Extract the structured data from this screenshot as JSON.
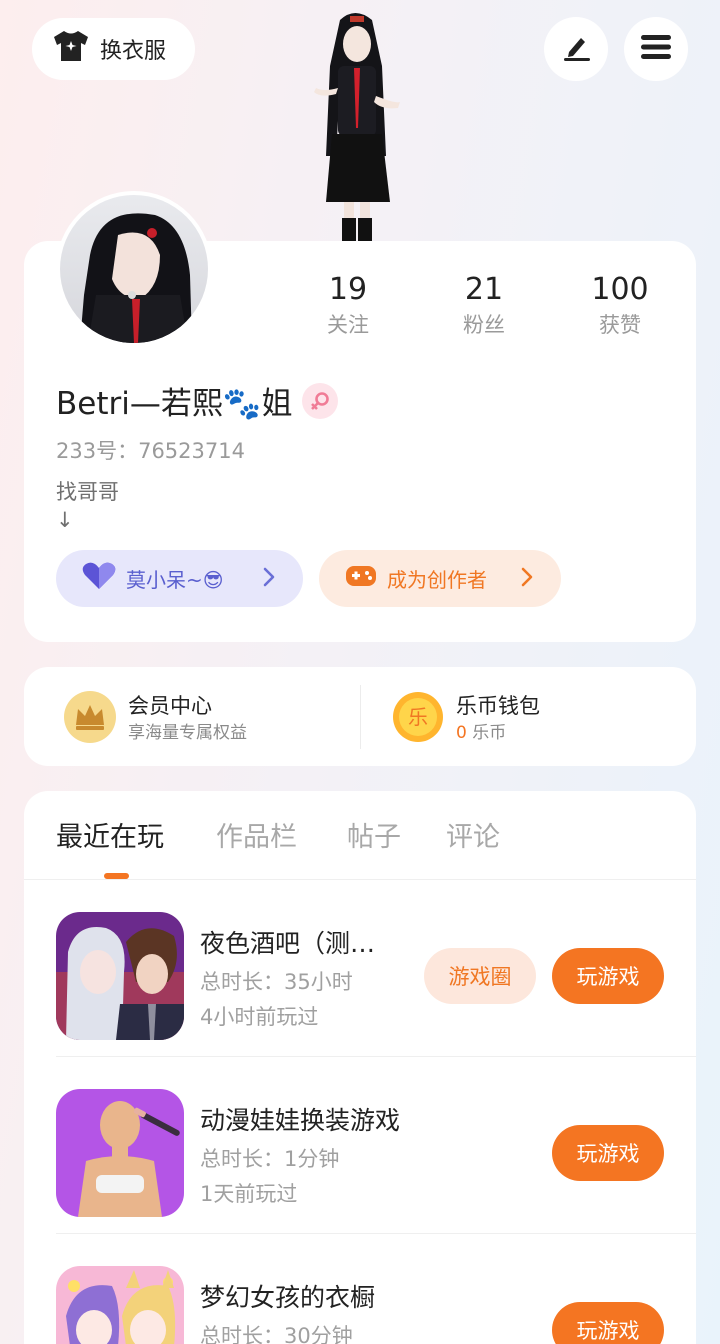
{
  "header": {
    "outfit_label": "换衣服",
    "edit_icon": "pencil-icon",
    "menu_icon": "menu-icon"
  },
  "profile": {
    "stats": [
      {
        "value": "19",
        "label": "关注"
      },
      {
        "value": "21",
        "label": "粉丝"
      },
      {
        "value": "100",
        "label": "获赞"
      }
    ],
    "nickname": "Betri—若熙🐾姐",
    "uid": "233号：76523714",
    "bio_line1": "找哥哥",
    "bio_line2": "↓",
    "cp_label": "莫小呆~😎",
    "creator_label": "成为创作者"
  },
  "member": {
    "vip_title": "会员中心",
    "vip_sub": "享海量专属权益",
    "wallet_title": "乐币钱包",
    "wallet_amount": "0",
    "wallet_unit": "乐币",
    "wallet_icon_char": "乐"
  },
  "tabs": [
    "最近在玩",
    "作品栏",
    "帖子",
    "评论"
  ],
  "games": [
    {
      "name": "夜色酒吧（测…",
      "duration": "总时长：35小时",
      "last_played": "4小时前玩过",
      "circle_label": "游戏圈",
      "play_label": "玩游戏"
    },
    {
      "name": "动漫娃娃换装游戏",
      "duration": "总时长：1分钟",
      "last_played": "1天前玩过",
      "play_label": "玩游戏"
    },
    {
      "name": "梦幻女孩的衣橱",
      "duration": "总时长：30分钟",
      "last_played": "",
      "play_label": "玩游戏"
    }
  ],
  "colors": {
    "accent": "#f47522",
    "cp_bg": "#e7e7fb",
    "creator_bg": "#fdebe0"
  }
}
